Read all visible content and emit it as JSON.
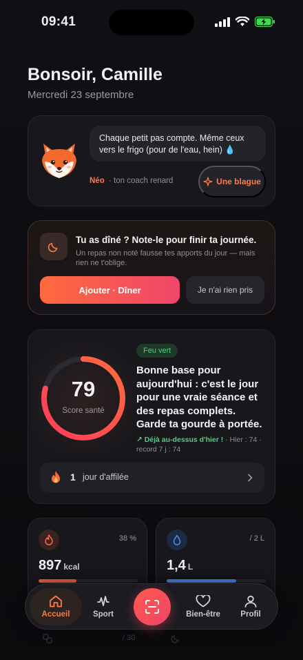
{
  "status_bar": {
    "time": "09:41"
  },
  "header": {
    "greeting": "Bonsoir, Camille",
    "date": "Mercredi 23 septembre"
  },
  "coach": {
    "message": "Chaque petit pas compte. Même ceux vers le frigo (pour de l'eau, hein) 💧",
    "name": "Néo",
    "role": "· ton coach renard",
    "joke_button": "Une blague"
  },
  "dinner_prompt": {
    "title": "Tu as dîné ? Note-le pour finir ta journée.",
    "subtitle": "Un repas non noté fausse tes apports du jour — mais rien ne t'oblige.",
    "add_button": "Ajouter · Dîner",
    "skip_button": "Je n'ai rien pris"
  },
  "score": {
    "value": "79",
    "label": "Score santé",
    "fraction": 0.79,
    "badge": "Feu vert",
    "message": "Bonne base pour aujourd'hui : c'est le jour pour une vraie séance et des repas complets. Garde ta gourde à portée.",
    "trend_up": "↗ Déjà au-dessus d'hier !",
    "trend_rest": " · Hier : 74 · record 7 j : 74",
    "streak_count": "1",
    "streak_label": "jour d'affilée"
  },
  "stats": {
    "calories": {
      "percent": "38 %",
      "value": "897",
      "unit": "kcal",
      "fill": 0.38,
      "color": "#ff6a3d"
    },
    "water": {
      "goal": "/ 2 L",
      "value": "1,4",
      "unit": "L",
      "fill": 0.7,
      "color": "#4f8df5"
    }
  },
  "below_fold": {
    "hint_right": "/ 30"
  },
  "nav": {
    "items": [
      {
        "label": "Accueil"
      },
      {
        "label": "Sport"
      },
      {
        "label": "Bien-être"
      },
      {
        "label": "Profil"
      }
    ]
  },
  "colors": {
    "accent": "#ff7a45",
    "success": "#4fd07a",
    "water": "#4f8df5"
  }
}
